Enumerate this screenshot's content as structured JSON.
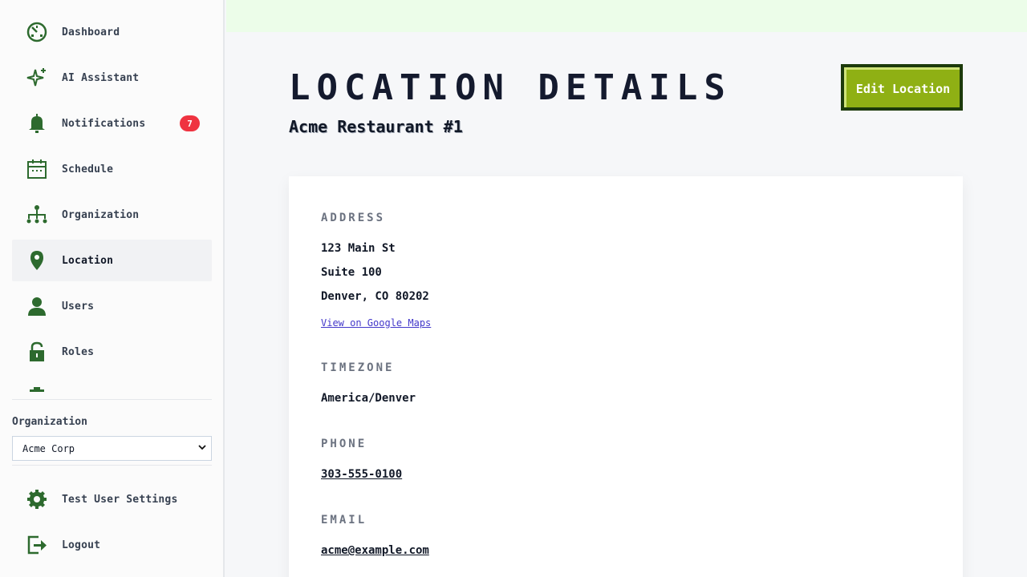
{
  "sidebar": {
    "items": [
      {
        "label": "Dashboard",
        "icon": "dashboard-icon"
      },
      {
        "label": "AI Assistant",
        "icon": "sparkle-icon"
      },
      {
        "label": "Notifications",
        "icon": "bell-icon",
        "badge": "7"
      },
      {
        "label": "Schedule",
        "icon": "calendar-icon"
      },
      {
        "label": "Organization",
        "icon": "org-chart-icon"
      },
      {
        "label": "Location",
        "icon": "map-pin-icon",
        "active": true
      },
      {
        "label": "Users",
        "icon": "user-icon"
      },
      {
        "label": "Roles",
        "icon": "lock-icon"
      }
    ],
    "org_label": "Organization",
    "org_selected": "Acme Corp",
    "bottom": [
      {
        "label": "Test User Settings",
        "icon": "gear-icon"
      },
      {
        "label": "Logout",
        "icon": "logout-icon"
      }
    ]
  },
  "page": {
    "title": "LOCATION DETAILS",
    "subtitle": "Acme Restaurant #1",
    "edit_button": "Edit Location"
  },
  "details": {
    "address_label": "ADDRESS",
    "address_line1": "123 Main St",
    "address_line2": "Suite 100",
    "address_line3": "Denver, CO 80202",
    "maps_link": "View on Google Maps",
    "timezone_label": "TIMEZONE",
    "timezone": "America/Denver",
    "phone_label": "PHONE",
    "phone": "303-555-0100",
    "email_label": "EMAIL",
    "email": "acme@example.com"
  },
  "colors": {
    "icon_green": "#2d6a2e",
    "accent_button": "#8fb014",
    "button_border": "#1c3a0b",
    "badge_red": "#ef3340",
    "topbar": "#ecfde9"
  }
}
